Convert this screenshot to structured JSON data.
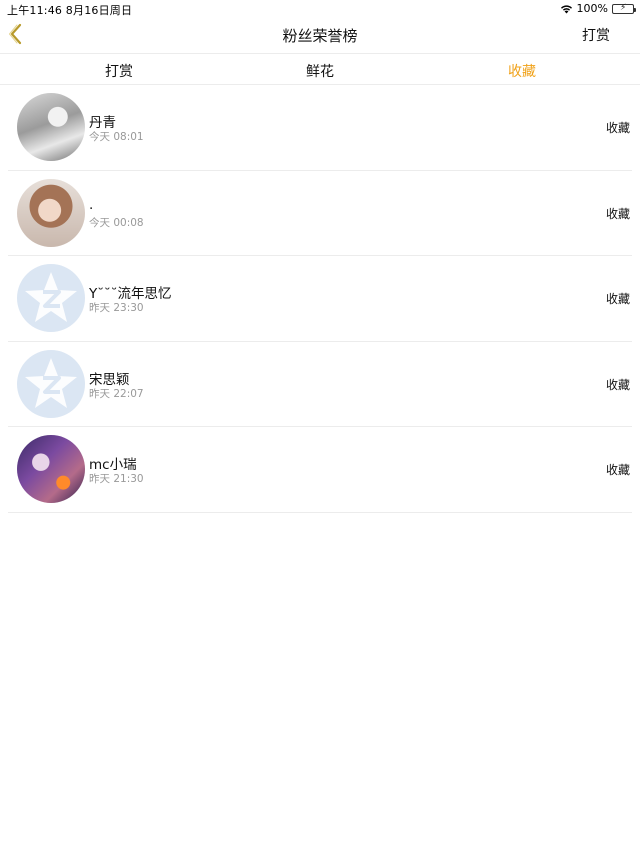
{
  "status_bar": {
    "time_date": "上午11:46   8月16日周日",
    "battery": "100%"
  },
  "nav": {
    "title": "粉丝荣誉榜",
    "right_button": "打赏",
    "back_icon": "chevron-left-icon"
  },
  "tabs": [
    {
      "label": "打赏",
      "active": false
    },
    {
      "label": "鲜花",
      "active": false
    },
    {
      "label": "收藏",
      "active": true
    }
  ],
  "accent_color": "#f0a21a",
  "fans": [
    {
      "name": "丹青",
      "time": "今天 08:01",
      "action": "收藏"
    },
    {
      "name": ".",
      "time": "今天 00:08",
      "action": "收藏"
    },
    {
      "name": "Y˘˘˘流年思忆",
      "time": "昨天 23:30",
      "action": "收藏"
    },
    {
      "name": "宋思颖",
      "time": "昨天 22:07",
      "action": "收藏"
    },
    {
      "name": "mc小瑞",
      "time": "昨天 21:30",
      "action": "收藏"
    }
  ]
}
